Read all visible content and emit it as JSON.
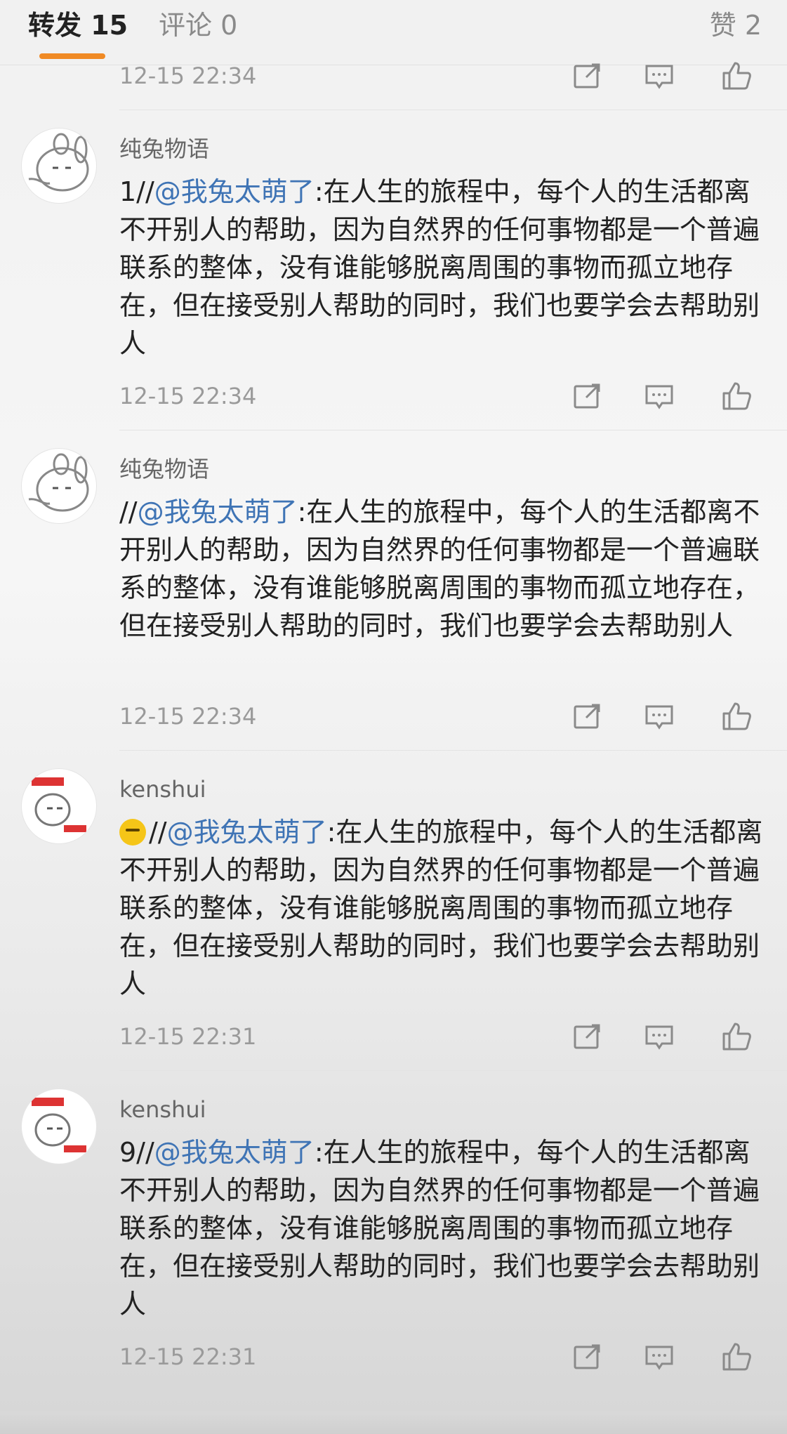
{
  "tabs": {
    "reposts": "转发 15",
    "comments": "评论 0",
    "likes": "赞 2"
  },
  "top_item": {
    "time": "12-15 22:34"
  },
  "items": [
    {
      "username": "纯兔物语",
      "prefix": "1//",
      "mention": "@我兔太萌了",
      "text": ":在人生的旅程中，每个人的生活都离不开别人的帮助，因为自然界的任何事物都是一个普遍联系的整体，没有谁能够脱离周围的事物而孤立地存在，但在接受别人帮助的同时，我们也要学会去帮助别人",
      "time": "12-15 22:34"
    },
    {
      "username": "纯兔物语",
      "prefix": "//",
      "mention": "@我兔太萌了",
      "text": ":在人生的旅程中，每个人的生活都离不开别人的帮助，因为自然界的任何事物都是一个普遍联系的整体，没有谁能够脱离周围的事物而孤立地存在，但在接受别人帮助的同时，我们也要学会去帮助别人",
      "time": "12-15 22:34"
    },
    {
      "username": "kenshui",
      "prefix": "//",
      "mention": "@我兔太萌了",
      "text": ":在人生的旅程中，每个人的生活都离不开别人的帮助，因为自然界的任何事物都是一个普遍联系的整体，没有谁能够脱离周围的事物而孤立地存在，但在接受别人帮助的同时，我们也要学会去帮助别人",
      "time": "12-15 22:31"
    },
    {
      "username": "kenshui",
      "prefix": "9//",
      "mention": "@我兔太萌了",
      "text": ":在人生的旅程中，每个人的生活都离不开别人的帮助，因为自然界的任何事物都是一个普遍联系的整体，没有谁能够脱离周围的事物而孤立地存在，但在接受别人帮助的同时，我们也要学会去帮助别人",
      "time": "12-15 22:31"
    }
  ],
  "colors": {
    "accent": "#f08a24",
    "mention": "#3f74b5"
  },
  "icons": [
    "share-icon",
    "comment-icon",
    "like-icon"
  ]
}
